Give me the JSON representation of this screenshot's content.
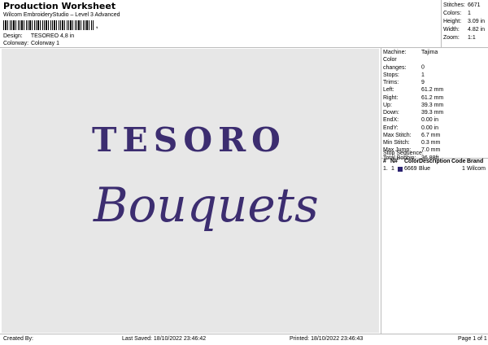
{
  "header": {
    "title": "Production Worksheet",
    "subtitle": "Wilcom EmbroideryStudio – Level 3 Advanced",
    "barcode_suffix": ","
  },
  "info": {
    "design_label": "Design:",
    "design_value": "TESOREO 4,8 in",
    "colorway_label": "Colorway:",
    "colorway_value": "Colorway 1"
  },
  "stats": [
    {
      "label": "Stitches:",
      "value": "6671"
    },
    {
      "label": "Colors:",
      "value": "1"
    },
    {
      "label": "Height:",
      "value": "3.09 in"
    },
    {
      "label": "Width:",
      "value": "4.82 in"
    },
    {
      "label": "Zoom:",
      "value": "1:1"
    }
  ],
  "design": {
    "line1": "TESORO",
    "line2": "Bouquets",
    "thread_color": "#3c2d70"
  },
  "machine": [
    {
      "label": "Machine:",
      "value": "Tajima"
    },
    {
      "label": "Color changes:",
      "value": "0"
    },
    {
      "label": "Stops:",
      "value": "1"
    },
    {
      "label": "Trims:",
      "value": "9"
    },
    {
      "label": "Left:",
      "value": "61.2 mm"
    },
    {
      "label": "Right:",
      "value": "61.2 mm"
    },
    {
      "label": "Up:",
      "value": "39.3 mm"
    },
    {
      "label": "Down:",
      "value": "39.3 mm"
    },
    {
      "label": "EndX:",
      "value": "0.00 in"
    },
    {
      "label": "EndY:",
      "value": "0.00 in"
    },
    {
      "label": "Max Stitch:",
      "value": "6.7 mm"
    },
    {
      "label": "Min Stitch:",
      "value": "0.3 mm"
    },
    {
      "label": "Max Jump:",
      "value": "7.0 mm"
    },
    {
      "label": "Total Bobbin:",
      "value": "36.88ft"
    }
  ],
  "sequence": {
    "title": "Stop Sequence:",
    "headers": {
      "num": "#",
      "n": "N#",
      "color": "Color",
      "desc": "Description",
      "code": "Code",
      "brand": "Brand"
    },
    "rows": [
      {
        "num": "1.",
        "n": "1",
        "color": "6669",
        "desc": "Blue",
        "code": "1",
        "brand": "Wilcom",
        "swatch": "#2b2270"
      }
    ]
  },
  "footer": {
    "created": "Created By:",
    "saved": "Last Saved: 18/10/2022 23:46:42",
    "printed": "Printed: 18/10/2022 23:46:43",
    "page": "Page 1 of 1"
  }
}
